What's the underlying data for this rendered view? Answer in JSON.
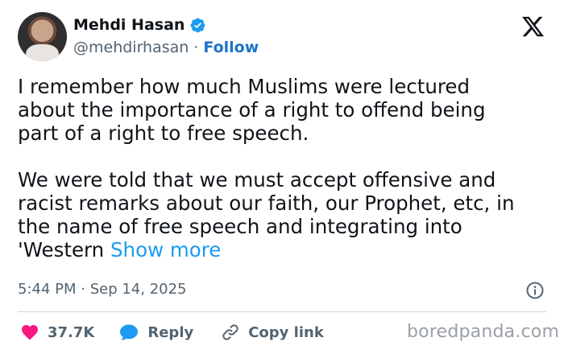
{
  "author": {
    "display_name": "Mehdi Hasan",
    "handle": "@mehdirhasan",
    "separator": "·",
    "follow_label": "Follow"
  },
  "tweet": {
    "text": "I remember how much Muslims were lectured\nabout the importance of a right to offend being\npart of a right to free speech.\n\nWe were told that we must accept offensive and\nracist remarks about our faith, our Prophet, etc, in\nthe name of free speech and integrating into\n'Western ",
    "show_more_label": "Show more",
    "timestamp": "5:44 PM · Sep 14, 2025"
  },
  "actions": {
    "like_count": "37.7K",
    "reply_label": "Reply",
    "copy_link_label": "Copy link"
  },
  "watermark": "boredpanda.com",
  "icons": [
    "verified-badge-icon",
    "x-logo-icon",
    "info-icon",
    "heart-icon",
    "reply-bubble-icon",
    "link-icon"
  ],
  "colors": {
    "accent": "#1d9bf0",
    "follow": "#1d74c9",
    "like": "#f91880",
    "muted": "#536471",
    "text": "#0f1419"
  }
}
